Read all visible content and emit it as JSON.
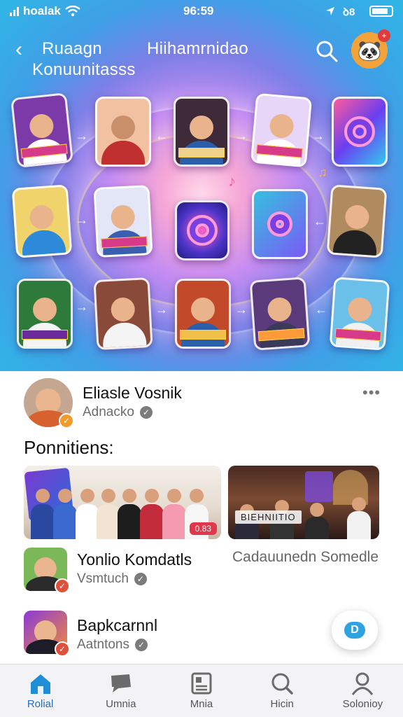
{
  "colors": {
    "accent": "#1e8fd6",
    "badge": "#f29a2a",
    "tag": "#e0384a"
  },
  "status_bar": {
    "carrier": "hoalak",
    "time": "96:59",
    "signal_text": "ıl"
  },
  "header": {
    "back_icon": "chevron-left-icon",
    "title_line1": "Ruaagn",
    "title_line2": "Konuunitasss",
    "center_title": "Hiihamrnidao",
    "search_icon": "search-icon",
    "profile_icon": "avatar",
    "profile_badge": "+"
  },
  "main": {
    "post": {
      "name": "Eliasle Vosnik",
      "handle": "Adnacko",
      "more_label": "•••"
    },
    "section_title": "Ponnitiens:",
    "photos": [
      {
        "tag": "0.83"
      },
      {
        "caption": "BIEHNIITIO"
      }
    ],
    "items": [
      {
        "name": "Yonlio Komdatls",
        "handle": "Vsmtuch"
      },
      {
        "name": "Bapkcarnnl",
        "handle": "Aatntons"
      }
    ],
    "right_label": "Cadauunedn Somedle"
  },
  "fab": {
    "label": "D"
  },
  "bottom_nav": {
    "tabs": [
      {
        "label": "Rolial",
        "icon": "home-icon"
      },
      {
        "label": "Umnia",
        "icon": "chat-icon"
      },
      {
        "label": "Mnia",
        "icon": "media-icon"
      },
      {
        "label": "Hicin",
        "icon": "search-icon"
      },
      {
        "label": "Solonioy",
        "icon": "profile-icon"
      }
    ]
  }
}
